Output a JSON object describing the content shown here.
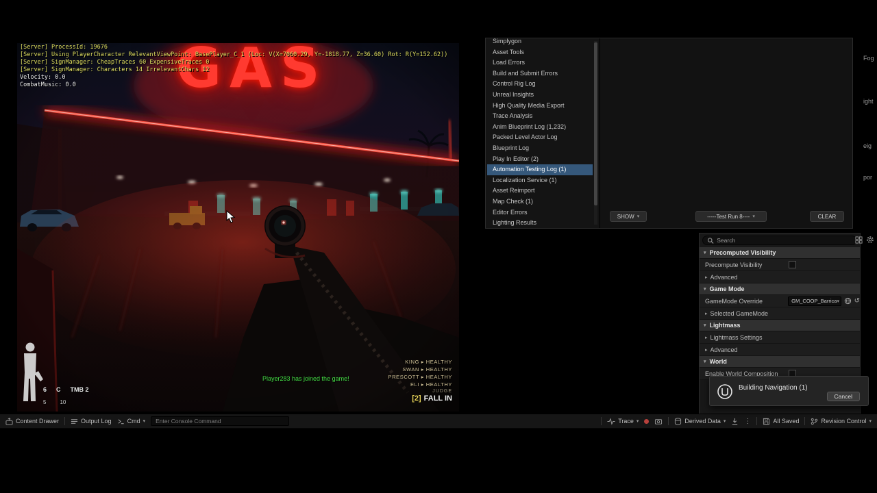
{
  "colors": {
    "neon_red": "#ff3a30",
    "selection_blue": "#35587b",
    "join_green": "#46e046",
    "debug_yellow": "#e0df60",
    "squad_tan": "#cfc096"
  },
  "icons": {
    "chevron_down": "▾",
    "chevron_right": "▸",
    "kebab": "⋮",
    "undo": "↺"
  },
  "game": {
    "sign_text": "GAS",
    "debug_lines": [
      "[Server] ProcessId: 19676",
      "[Server] Using PlayerCharacter RelevantViewPoint: BasePlayer_C_1 (Loc: V(X=7060.29, Y=-1818.77, Z=36.60) Rot: R(Y=152.62))",
      "[Server] SignManager: CheapTraces 60 ExpensiveTraces 0",
      "[Server] SignManager: Characters 14 IrrelevantChars 12"
    ],
    "velocity_line": "Velocity: 0.0",
    "combat_music_line": "CombatMusic: 0.0",
    "join_message": "Player283 has joined the game!",
    "squad_status": [
      "KING ▸ HEALTHY",
      "SWAN ▸ HEALTHY",
      "PRESCOTT ▸ HEALTHY",
      "ELI ▸ HEALTHY"
    ],
    "order": {
      "leader": "JUDGE",
      "key": "[2]",
      "command": "FALL IN"
    },
    "ammo": {
      "mag": "6",
      "firemode": "C",
      "weapon": "TMB 2",
      "reserve": "5",
      "total": "10"
    }
  },
  "message_log": {
    "categories": [
      "Simplygon",
      "Asset Tools",
      "Load Errors",
      "Build and Submit Errors",
      "Control Rig Log",
      "Unreal Insights",
      "High Quality Media Export",
      "Trace Analysis",
      "Anim Blueprint Log (1,232)",
      "Packed Level Actor Log",
      "Blueprint Log",
      "Play In Editor (2)",
      "Automation Testing Log (1)",
      "Localization Service (1)",
      "Asset Reimport",
      "Map Check (1)",
      "Editor Errors",
      "Lighting Results"
    ],
    "selected": "Automation Testing Log (1)",
    "show_button": "SHOW",
    "run_selector": "-----Test Run 8----",
    "clear_button": "CLEAR"
  },
  "details": {
    "search_placeholder": "Search",
    "sections": {
      "precomputed_visibility": "Precomputed Visibility",
      "game_mode": "Game Mode",
      "lightmass": "Lightmass",
      "world": "World"
    },
    "rows": {
      "precompute_visibility": "Precompute Visibility",
      "advanced1": "Advanced",
      "gamemode_override": "GameMode Override",
      "gamemode_value": "GM_COOP_Barrica",
      "selected_gamemode": "Selected GameMode",
      "lightmass_settings": "Lightmass Settings",
      "advanced2": "Advanced",
      "enable_world_composition": "Enable World Composition"
    }
  },
  "toast": {
    "title": "Building Navigation (1)",
    "cancel_label": "Cancel"
  },
  "status_bar": {
    "content_drawer": "Content Drawer",
    "output_log": "Output Log",
    "cmd": "Cmd",
    "console_placeholder": "Enter Console Command",
    "trace": "Trace",
    "derived_data": "Derived Data",
    "all_saved": "All Saved",
    "revision_control": "Revision Control"
  },
  "edge_fragments": [
    "Fog",
    "ight",
    "eig",
    "por"
  ]
}
